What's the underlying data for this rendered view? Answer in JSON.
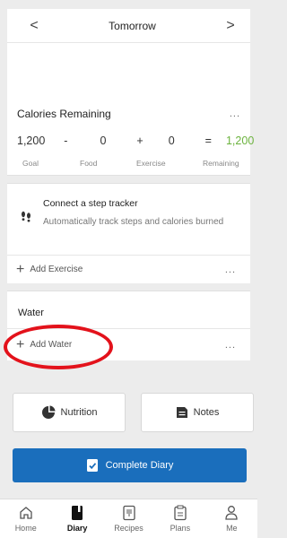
{
  "header": {
    "prev": "<",
    "title": "Tomorrow",
    "next": ">"
  },
  "calories": {
    "title": "Calories Remaining",
    "more": "...",
    "goal": "1,200",
    "minus": "-",
    "food": "0",
    "plus": "+",
    "exercise": "0",
    "equals": "=",
    "remaining": "1,200",
    "labels": {
      "goal": "Goal",
      "food": "Food",
      "exercise": "Exercise",
      "remaining": "Remaining"
    }
  },
  "steps": {
    "title": "Connect a step tracker",
    "desc": "Automatically track steps and calories burned"
  },
  "exercise": {
    "add_label": "Add Exercise",
    "more": "..."
  },
  "water": {
    "title": "Water",
    "add_label": "Add Water",
    "more": "..."
  },
  "buttons": {
    "nutrition": "Nutrition",
    "notes": "Notes",
    "complete": "Complete Diary"
  },
  "tabs": [
    {
      "label": "Home"
    },
    {
      "label": "Diary"
    },
    {
      "label": "Recipes"
    },
    {
      "label": "Plans"
    },
    {
      "label": "Me"
    }
  ],
  "colors": {
    "primary": "#1a6ebc",
    "remaining": "#6cb33e",
    "annotation": "#e3121b"
  }
}
